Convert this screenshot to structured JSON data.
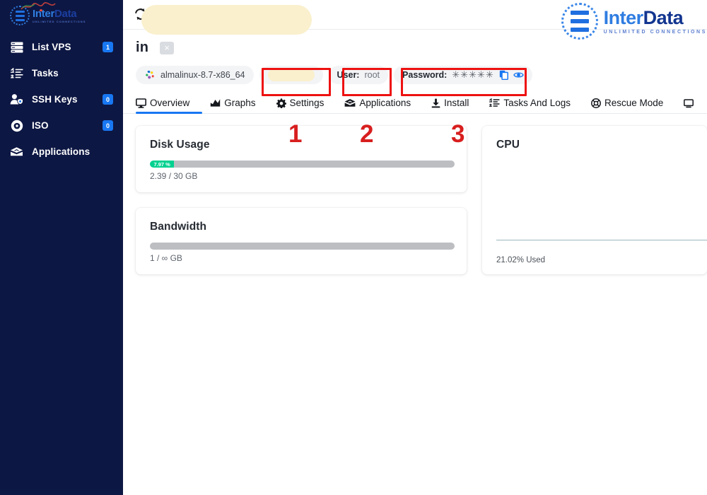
{
  "brand": {
    "name_part1": "Inter",
    "name_part2": "Data",
    "tagline": "UNLIMITED CONNECTIONS"
  },
  "sidebar": {
    "items": [
      {
        "label": "List VPS",
        "badge": "1",
        "icon": "server-list-icon"
      },
      {
        "label": "Tasks",
        "badge": "",
        "icon": "tasks-list-icon"
      },
      {
        "label": "SSH Keys",
        "badge": "0",
        "icon": "user-key-icon"
      },
      {
        "label": "ISO",
        "badge": "0",
        "icon": "disc-icon"
      },
      {
        "label": "Applications",
        "badge": "",
        "icon": "apps-box-icon"
      }
    ]
  },
  "topbar": {
    "refresh_icon": "refresh-icon"
  },
  "vps": {
    "title_visible_prefix": "in",
    "title_redacted": true,
    "close_label": "×",
    "os_pill": "almalinux-8.7-x86_64",
    "ip_pill_redacted": true,
    "user_label": "User:",
    "user_value": "root",
    "password_label": "Password:",
    "password_masked": "✳✳✳✳✳",
    "copy_icon": "copy-icon",
    "eye_icon": "eye-icon"
  },
  "tabs": [
    {
      "label": "Overview",
      "icon": "monitor-icon",
      "active": true
    },
    {
      "label": "Graphs",
      "icon": "chart-icon",
      "active": false
    },
    {
      "label": "Settings",
      "icon": "gear-icon",
      "active": false
    },
    {
      "label": "Applications",
      "icon": "apps-box-icon",
      "active": false
    },
    {
      "label": "Install",
      "icon": "download-icon",
      "active": false
    },
    {
      "label": "Tasks And Logs",
      "icon": "tasks-list-icon",
      "active": false
    },
    {
      "label": "Rescue Mode",
      "icon": "lifebuoy-icon",
      "active": false
    }
  ],
  "cards": {
    "disk": {
      "title": "Disk Usage",
      "percent_label": "7.97 %",
      "percent_value": 7.97,
      "sub": "2.39 / 30 GB"
    },
    "bandwidth": {
      "title": "Bandwidth",
      "percent_value": 0,
      "sub": "1 / ∞ GB"
    },
    "cpu": {
      "title": "CPU",
      "used_label": "21.02% Used",
      "used_value": 21.02
    }
  },
  "annotations": {
    "numbers": [
      "1",
      "2",
      "3"
    ],
    "color": "#d81e1e"
  },
  "colors": {
    "sidebar_bg": "#0d1743",
    "accent_blue": "#1877f2",
    "progress_green": "#00d18f",
    "annotation_red": "#ee1111",
    "redaction": "#faf0cd"
  }
}
